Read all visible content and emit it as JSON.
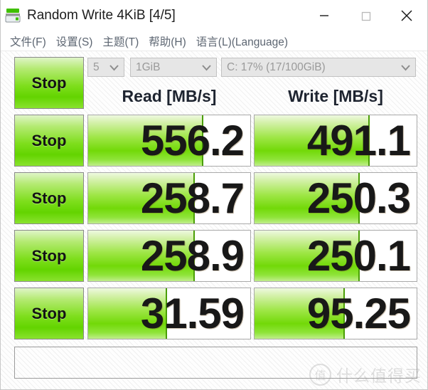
{
  "window": {
    "title": "Random Write 4KiB [4/5]",
    "icon": "disk-drive-icon",
    "controls": {
      "minimize": "minimize-icon",
      "maximize": "maximize-icon",
      "close": "close-icon"
    }
  },
  "menubar": {
    "items": [
      {
        "label": "文件(F)"
      },
      {
        "label": "设置(S)"
      },
      {
        "label": "主题(T)"
      },
      {
        "label": "帮助(H)"
      },
      {
        "label": "语言(L)(Language)"
      }
    ]
  },
  "toolbar": {
    "stop_label": "Stop",
    "combo_count": {
      "value": "5",
      "arrow": "chevron-down-icon"
    },
    "combo_size": {
      "value": "1GiB",
      "arrow": "chevron-down-icon"
    },
    "combo_drive": {
      "value": "C: 17% (17/100GiB)",
      "arrow": "chevron-down-icon"
    }
  },
  "columns": {
    "read_header": "Read [MB/s]",
    "write_header": "Write [MB/s]"
  },
  "rows": [
    {
      "stop_label": "Stop",
      "read": "556.2",
      "write": "491.1",
      "read_fill_pct": 70,
      "write_fill_pct": 70
    },
    {
      "stop_label": "Stop",
      "read": "258.7",
      "write": "250.3",
      "read_fill_pct": 65,
      "write_fill_pct": 64
    },
    {
      "stop_label": "Stop",
      "read": "258.9",
      "write": "250.1",
      "read_fill_pct": 65,
      "write_fill_pct": 64
    },
    {
      "stop_label": "Stop",
      "read": "31.59",
      "write": "95.25",
      "read_fill_pct": 48,
      "write_fill_pct": 55
    }
  ],
  "status": {
    "text": ""
  },
  "watermark": {
    "logo": "值",
    "text": "什么值得买"
  },
  "colors": {
    "accent_green": "#72d908",
    "green_edge": "#4a9e06",
    "menu_text": "#5d6672",
    "value_text": "#181818"
  }
}
